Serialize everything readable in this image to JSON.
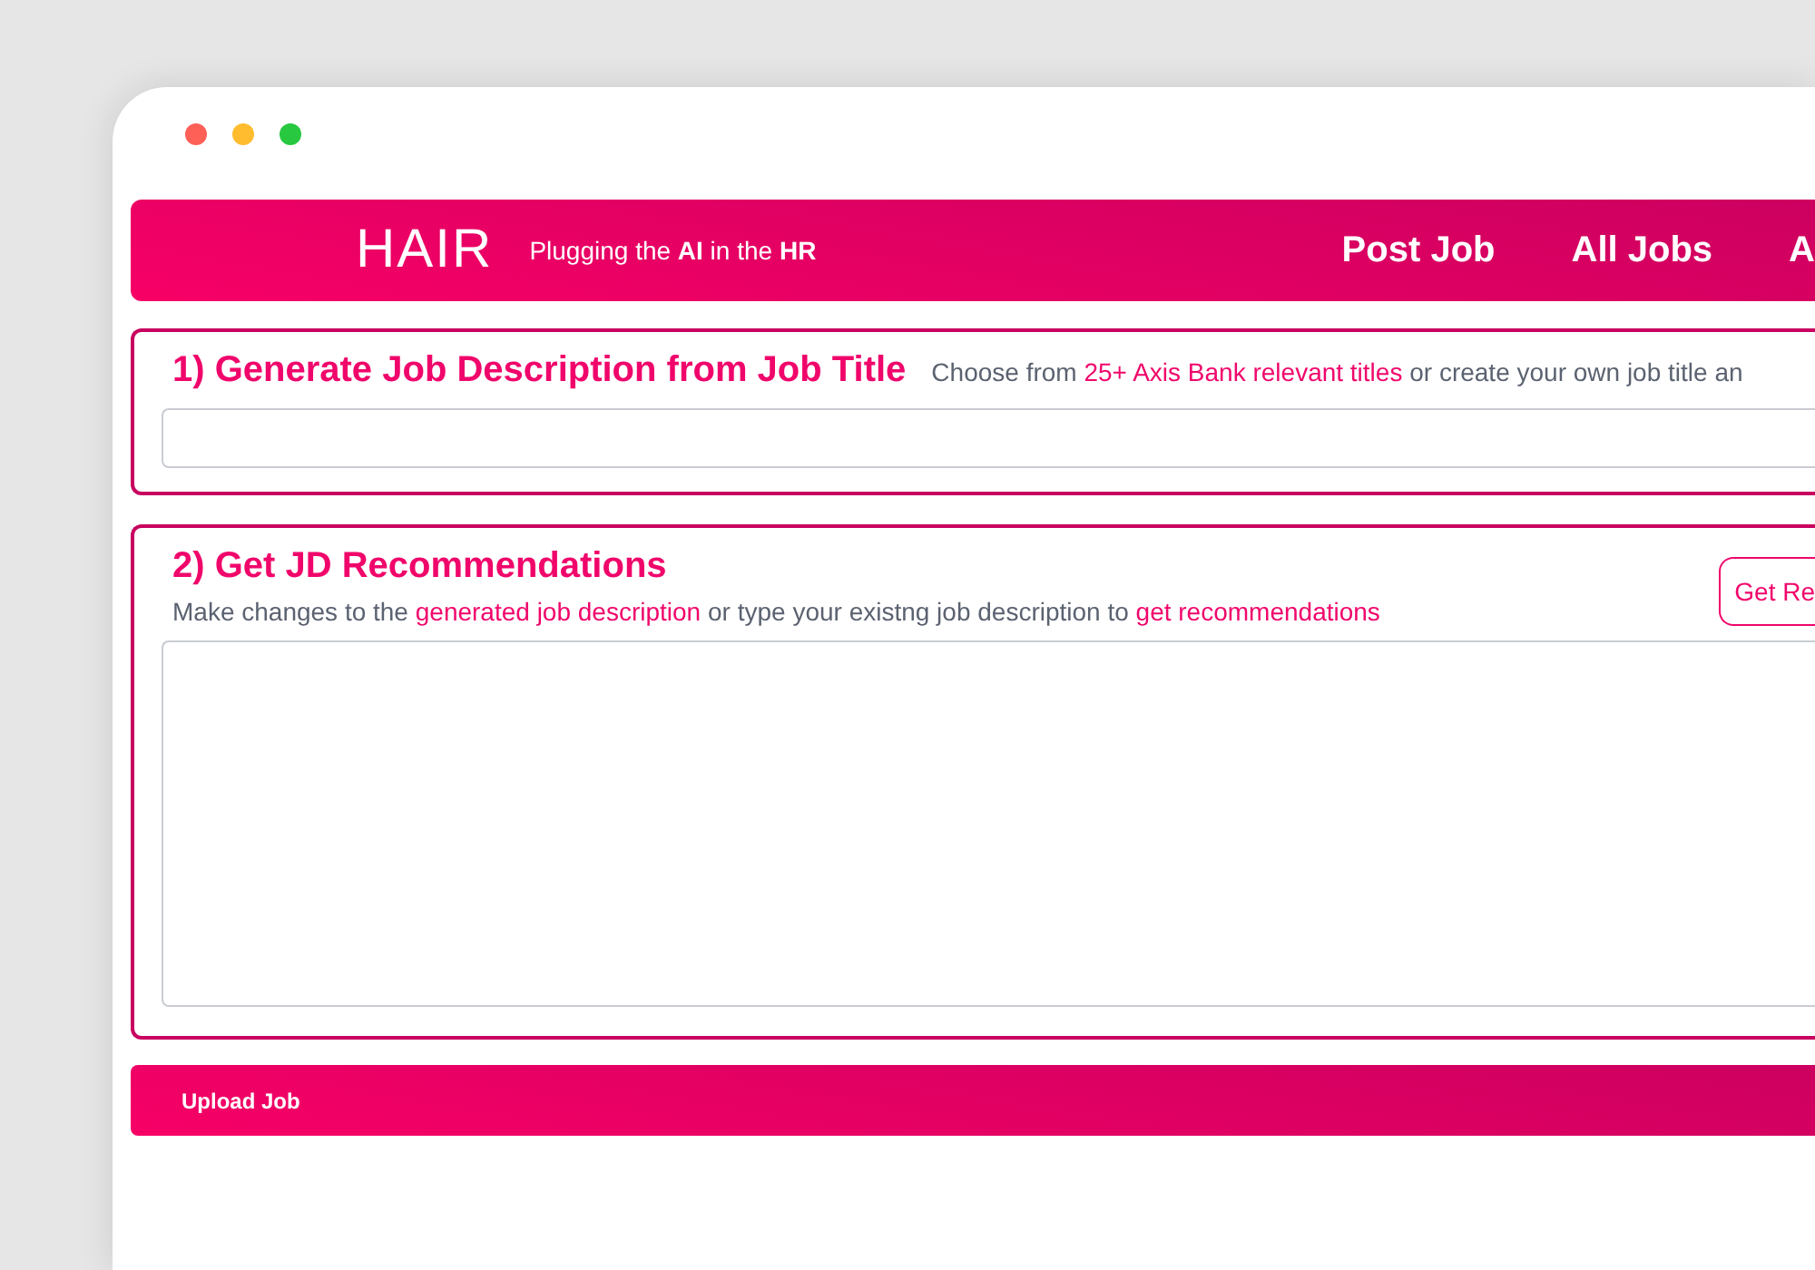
{
  "window": {
    "controls": [
      {
        "color": "#fe5f57"
      },
      {
        "color": "#febc2e"
      },
      {
        "color": "#28c840"
      }
    ]
  },
  "header": {
    "logo": "HAIR",
    "tagline": "Plugging the **AI** in the **HR**",
    "nav": [
      "Post Job",
      "All Jobs",
      "A"
    ]
  },
  "generate": {
    "title": "1) Generate Job Description from Job Title",
    "hint": [
      {
        "text": "Choose from ",
        "highlight": false
      },
      {
        "text": "25+ Axis Bank relevant titles",
        "highlight": true
      },
      {
        "text": " or create your own job title an",
        "highlight": false
      }
    ]
  },
  "recommend": {
    "title": "2) Get JD Recommendations",
    "hint": [
      {
        "text": "Make changes to the ",
        "highlight": false
      },
      {
        "text": "generated job description",
        "highlight": true
      },
      {
        "text": " or type your existng job description to ",
        "highlight": false
      },
      {
        "text": "get recommendations",
        "highlight": true
      }
    ],
    "button": "Get Re"
  },
  "footer": {
    "label": "Upload Job"
  }
}
